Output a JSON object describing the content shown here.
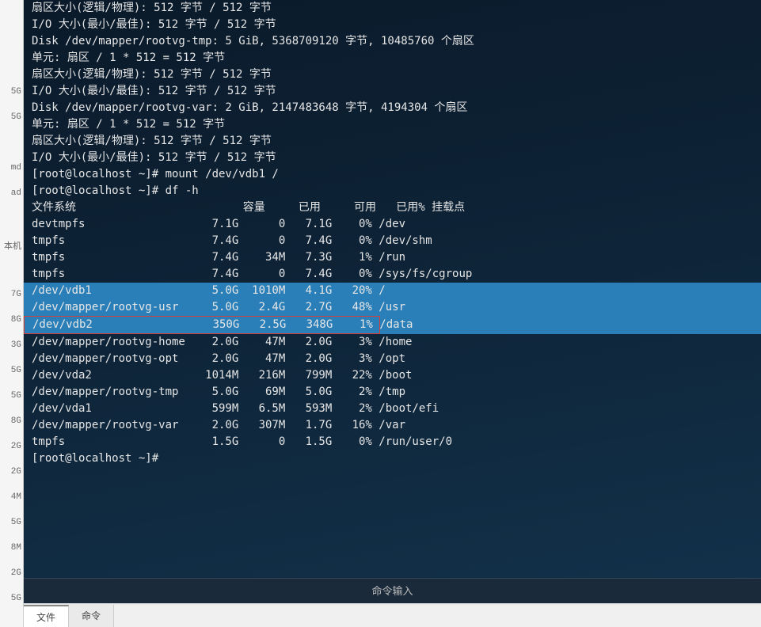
{
  "left_panel": {
    "labels": [
      "5G",
      "5G",
      "",
      "md",
      "ad",
      "",
      "本机",
      "",
      "7G",
      "8G",
      "3G",
      "5G",
      "5G",
      "8G",
      "2G",
      "2G",
      "4M",
      "5G",
      "8M",
      "2G",
      "5G"
    ]
  },
  "terminal": {
    "pre_lines": [
      "扇区大小(逻辑/物理): 512 字节 / 512 字节",
      "I/O 大小(最小/最佳): 512 字节 / 512 字节",
      "",
      "",
      "Disk /dev/mapper/rootvg-tmp: 5 GiB, 5368709120 字节, 10485760 个扇区",
      "单元: 扇区 / 1 * 512 = 512 字节",
      "扇区大小(逻辑/物理): 512 字节 / 512 字节",
      "I/O 大小(最小/最佳): 512 字节 / 512 字节",
      "",
      "",
      "Disk /dev/mapper/rootvg-var: 2 GiB, 2147483648 字节, 4194304 个扇区",
      "单元: 扇区 / 1 * 512 = 512 字节",
      "扇区大小(逻辑/物理): 512 字节 / 512 字节",
      "I/O 大小(最小/最佳): 512 字节 / 512 字节",
      "[root@localhost ~]# mount /dev/vdb1 /",
      "[root@localhost ~]# df -h"
    ],
    "df_header": {
      "fs": "文件系统",
      "size": "容量",
      "used": "已用",
      "avail": "可用",
      "usep": "已用%",
      "mount": "挂载点"
    },
    "df_rows": [
      {
        "fs": "devtmpfs",
        "size": "7.1G",
        "used": "0",
        "avail": "7.1G",
        "usep": "0%",
        "mount": "/dev",
        "hl": false,
        "box": false
      },
      {
        "fs": "tmpfs",
        "size": "7.4G",
        "used": "0",
        "avail": "7.4G",
        "usep": "0%",
        "mount": "/dev/shm",
        "hl": false,
        "box": false
      },
      {
        "fs": "tmpfs",
        "size": "7.4G",
        "used": "34M",
        "avail": "7.3G",
        "usep": "1%",
        "mount": "/run",
        "hl": false,
        "box": false
      },
      {
        "fs": "tmpfs",
        "size": "7.4G",
        "used": "0",
        "avail": "7.4G",
        "usep": "0%",
        "mount": "/sys/fs/cgroup",
        "hl": false,
        "box": false
      },
      {
        "fs": "/dev/vdb1",
        "size": "5.0G",
        "used": "1010M",
        "avail": "4.1G",
        "usep": "20%",
        "mount": "/",
        "hl": true,
        "box": false
      },
      {
        "fs": "/dev/mapper/rootvg-usr",
        "size": "5.0G",
        "used": "2.4G",
        "avail": "2.7G",
        "usep": "48%",
        "mount": "/usr",
        "hl": true,
        "box": false
      },
      {
        "fs": "/dev/vdb2",
        "size": "350G",
        "used": "2.5G",
        "avail": "348G",
        "usep": "1%",
        "mount": "/data",
        "hl": true,
        "box": true
      },
      {
        "fs": "/dev/mapper/rootvg-home",
        "size": "2.0G",
        "used": "47M",
        "avail": "2.0G",
        "usep": "3%",
        "mount": "/home",
        "hl": false,
        "box": false
      },
      {
        "fs": "/dev/mapper/rootvg-opt",
        "size": "2.0G",
        "used": "47M",
        "avail": "2.0G",
        "usep": "3%",
        "mount": "/opt",
        "hl": false,
        "box": false
      },
      {
        "fs": "/dev/vda2",
        "size": "1014M",
        "used": "216M",
        "avail": "799M",
        "usep": "22%",
        "mount": "/boot",
        "hl": false,
        "box": false
      },
      {
        "fs": "/dev/mapper/rootvg-tmp",
        "size": "5.0G",
        "used": "69M",
        "avail": "5.0G",
        "usep": "2%",
        "mount": "/tmp",
        "hl": false,
        "box": false
      },
      {
        "fs": "/dev/vda1",
        "size": "599M",
        "used": "6.5M",
        "avail": "593M",
        "usep": "2%",
        "mount": "/boot/efi",
        "hl": false,
        "box": false
      },
      {
        "fs": "/dev/mapper/rootvg-var",
        "size": "2.0G",
        "used": "307M",
        "avail": "1.7G",
        "usep": "16%",
        "mount": "/var",
        "hl": false,
        "box": false
      },
      {
        "fs": "tmpfs",
        "size": "1.5G",
        "used": "0",
        "avail": "1.5G",
        "usep": "0%",
        "mount": "/run/user/0",
        "hl": false,
        "box": false
      }
    ],
    "prompt_line": "[root@localhost ~]# "
  },
  "input_bar": {
    "label": "命令输入"
  },
  "tabs": {
    "file": "文件",
    "cmd": "命令"
  }
}
